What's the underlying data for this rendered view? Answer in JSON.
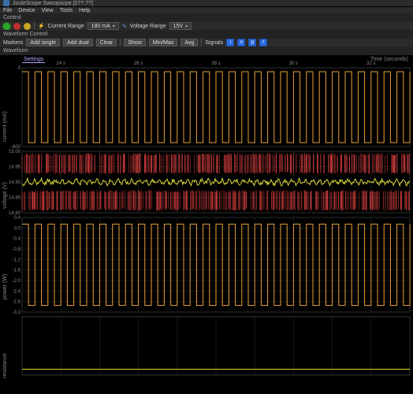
{
  "titlebar": {
    "text": "JouleScope Swoopscpe [0??.??]"
  },
  "menu": {
    "items": [
      "File",
      "Device",
      "View",
      "Tools",
      "Help"
    ]
  },
  "sections": {
    "control": "Control",
    "waveform_control": "Waveform Control",
    "waveform": "Waveform"
  },
  "control_toolbar": {
    "current_range_label": "Current Range",
    "current_range_value": "180 mA",
    "voltage_range_label": "Voltage Range",
    "voltage_range_value": "15V"
  },
  "waveform_toolbar": {
    "markers": "Markers",
    "items": [
      "Add single",
      "Add dual",
      "Clear",
      "Show"
    ],
    "minmax": "Min/Max",
    "avg": "Avg",
    "signals_label": "Signals",
    "signals": [
      "i",
      "v",
      "p",
      "r"
    ]
  },
  "plot": {
    "xlabel": "Time (seconds)",
    "settings_tab": "Settings",
    "x_ticks": [
      "24 s",
      "26 s",
      "28 s",
      "30 s",
      "32 s"
    ],
    "panels": [
      {
        "id": "current",
        "ylabel": "current (mA)",
        "ticks": [
          "0",
          "-600"
        ]
      },
      {
        "id": "voltage",
        "ylabel": "voltage (V)",
        "ticks": [
          "15.00",
          "14.95",
          "14.90",
          "14.85",
          "14.80"
        ]
      },
      {
        "id": "power",
        "ylabel": "power (W)",
        "ticks": [
          "0.4",
          "0.0",
          "-0.4",
          "-0.8",
          "-1.2",
          "-1.6",
          "-2.0",
          "-2.4",
          "-2.8",
          "-3.2"
        ]
      },
      {
        "id": "resistance",
        "ylabel": "resistance",
        "ticks": []
      }
    ]
  },
  "colors": {
    "trace_main": "#e8a23a",
    "trace_minmax": "#d84040",
    "trace_avg": "#e4e838",
    "grid": "#2a2a2a",
    "axis": "#555"
  }
}
